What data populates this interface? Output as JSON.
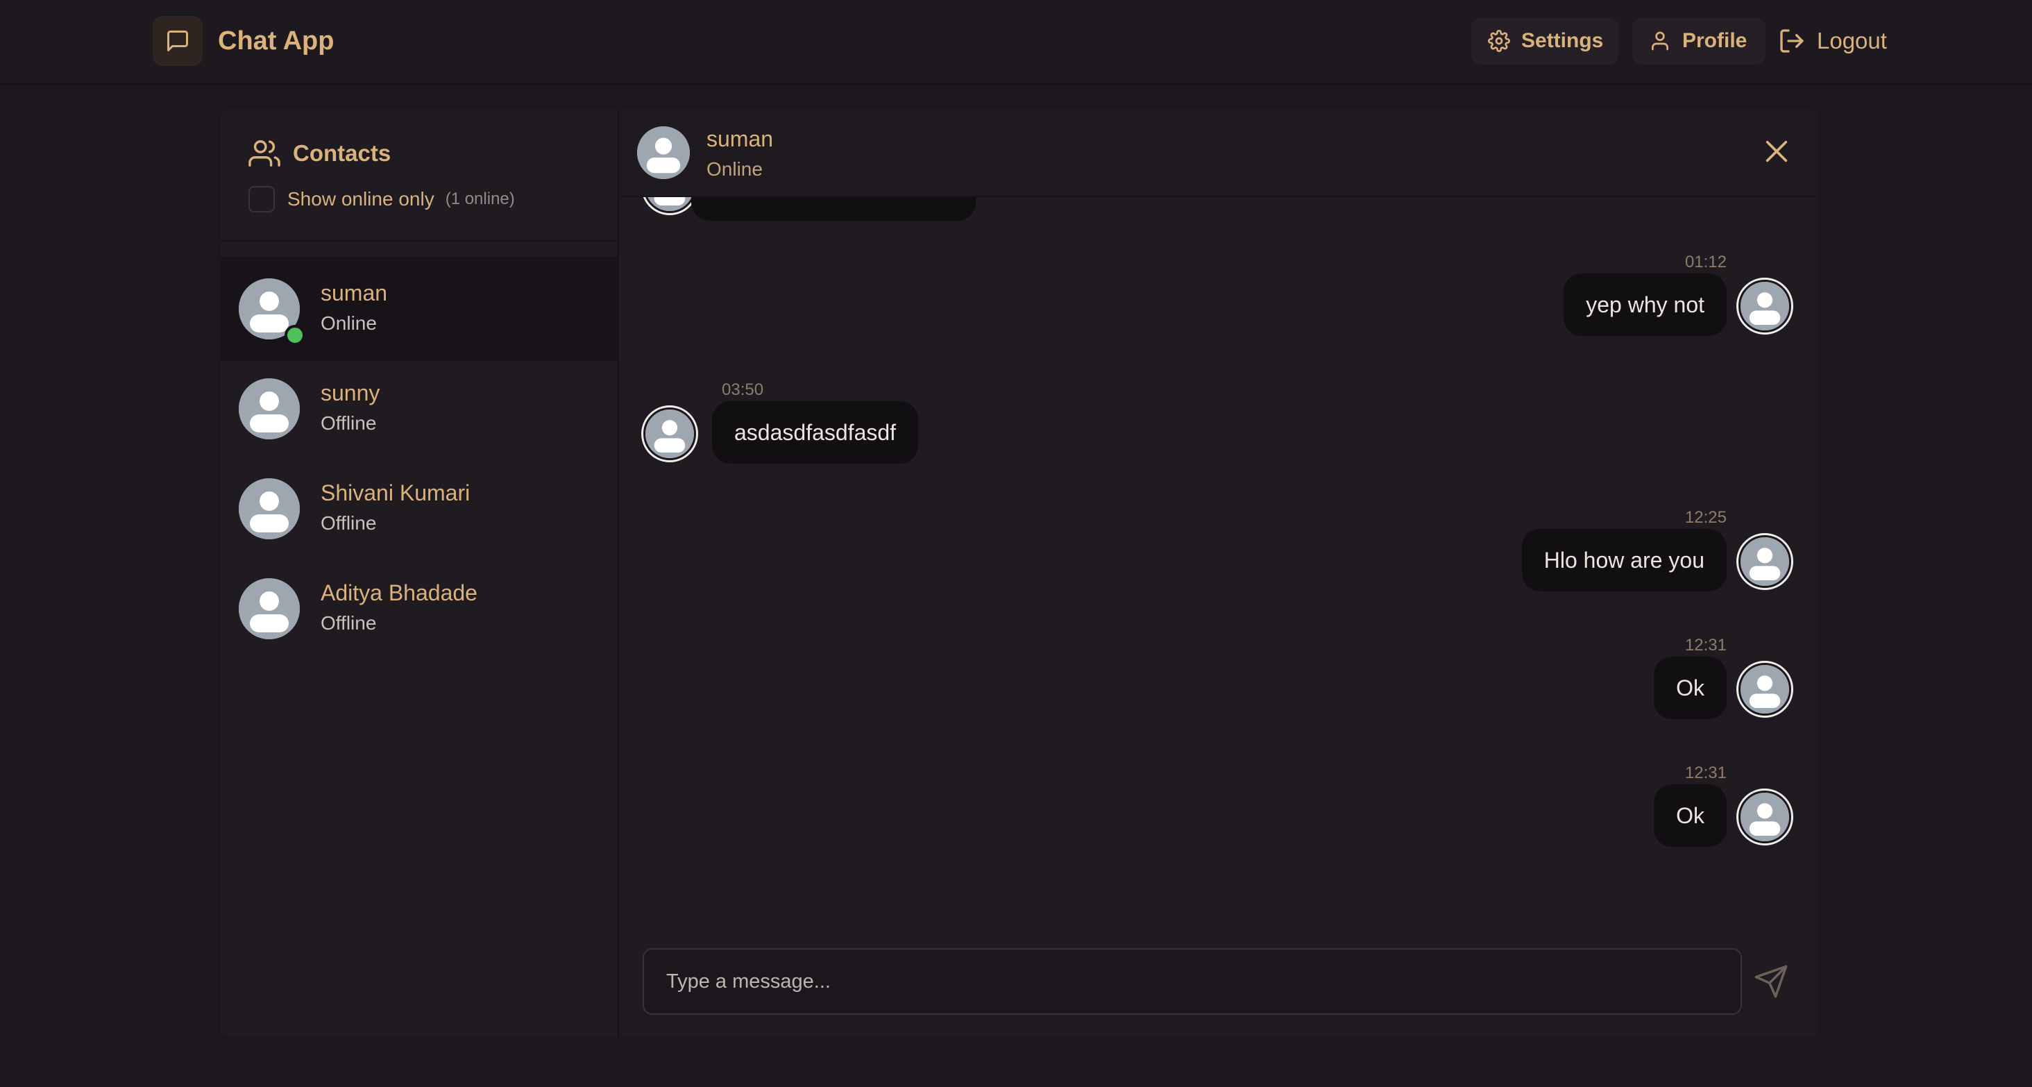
{
  "app": {
    "title": "Chat App"
  },
  "nav": {
    "settings": "Settings",
    "profile": "Profile",
    "logout": "Logout"
  },
  "sidebar": {
    "title": "Contacts",
    "filter_label": "Show online only",
    "online_count": "(1 online)",
    "contacts": [
      {
        "name": "suman",
        "status": "Online",
        "active": true
      },
      {
        "name": "sunny",
        "status": "Offline"
      },
      {
        "name": "Shivani Kumari",
        "status": "Offline"
      },
      {
        "name": "Aditya Bhadade",
        "status": "Offline"
      }
    ]
  },
  "chat": {
    "name": "suman",
    "status": "Online",
    "messages": [
      {
        "time": "01:12",
        "text": "yep why not",
        "from": "me"
      },
      {
        "time": "03:50",
        "text": "asdasdfasdfasdf",
        "from": "them"
      },
      {
        "time": "12:25",
        "text": "Hlo how are you",
        "from": "me"
      },
      {
        "time": "12:31",
        "text": "Ok",
        "from": "me"
      },
      {
        "time": "12:31",
        "text": "Ok",
        "from": "me"
      }
    ],
    "input_placeholder": "Type a message..."
  },
  "colors": {
    "accent": "#d9b27c",
    "online": "#4fc05a",
    "background": "#1c171d"
  }
}
